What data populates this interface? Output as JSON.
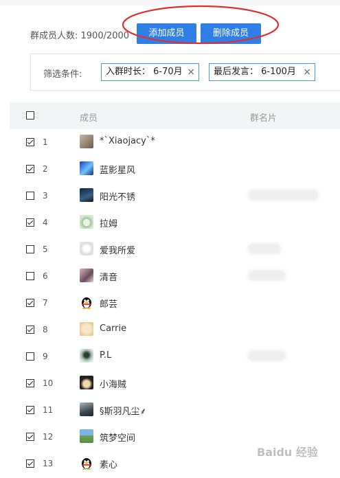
{
  "header": {
    "member_count": "群成员人数: 1900/2000",
    "add_button": "添加成员",
    "delete_button": "删除成员"
  },
  "filter": {
    "label": "筛选条件:",
    "tag1": "入群时长： 6-70月",
    "tag2": "最后发言： 6-100月",
    "remove_icon": "×"
  },
  "table": {
    "col_member": "成员",
    "col_card": "群名片",
    "rows": [
      {
        "index": "1",
        "name": "*`Xiaojacy`*",
        "checked": true,
        "avatar": "photo-avatar"
      },
      {
        "index": "2",
        "name": "蓝影星风",
        "checked": true,
        "avatar": "blue-abstract-avatar"
      },
      {
        "index": "3",
        "name": "阳光不锈",
        "checked": false,
        "avatar": "dark-photo-avatar"
      },
      {
        "index": "4",
        "name": "拉姆",
        "checked": true,
        "avatar": "green-drawing-avatar"
      },
      {
        "index": "5",
        "name": "爱我所爱",
        "checked": false,
        "avatar": "light-drawing-avatar"
      },
      {
        "index": "6",
        "name": "清音",
        "checked": false,
        "avatar": "portrait-avatar"
      },
      {
        "index": "7",
        "name": "郎芸",
        "checked": true,
        "avatar": "qq-penguin-avatar"
      },
      {
        "index": "8",
        "name": "Carrie",
        "checked": true,
        "avatar": "cartoon-avatar"
      },
      {
        "index": "9",
        "name": "P.L",
        "checked": false,
        "avatar": "sketch-avatar"
      },
      {
        "index": "10",
        "name": "小海贼",
        "checked": true,
        "avatar": "anime-avatar"
      },
      {
        "index": "11",
        "name": "§斯羽凡尘⸙",
        "checked": true,
        "avatar": "person-photo-avatar"
      },
      {
        "index": "12",
        "name": "筑梦空间",
        "checked": true,
        "avatar": "landscape-avatar"
      },
      {
        "index": "13",
        "name": "素心",
        "checked": true,
        "avatar": "qq-penguin-avatar"
      }
    ]
  },
  "watermark": "Baidu 经验",
  "colors": {
    "button": "#2f7fe6",
    "annotation": "#e0302e",
    "tag_border": "#4a9ae0",
    "header_bg": "#f3f4f6"
  }
}
